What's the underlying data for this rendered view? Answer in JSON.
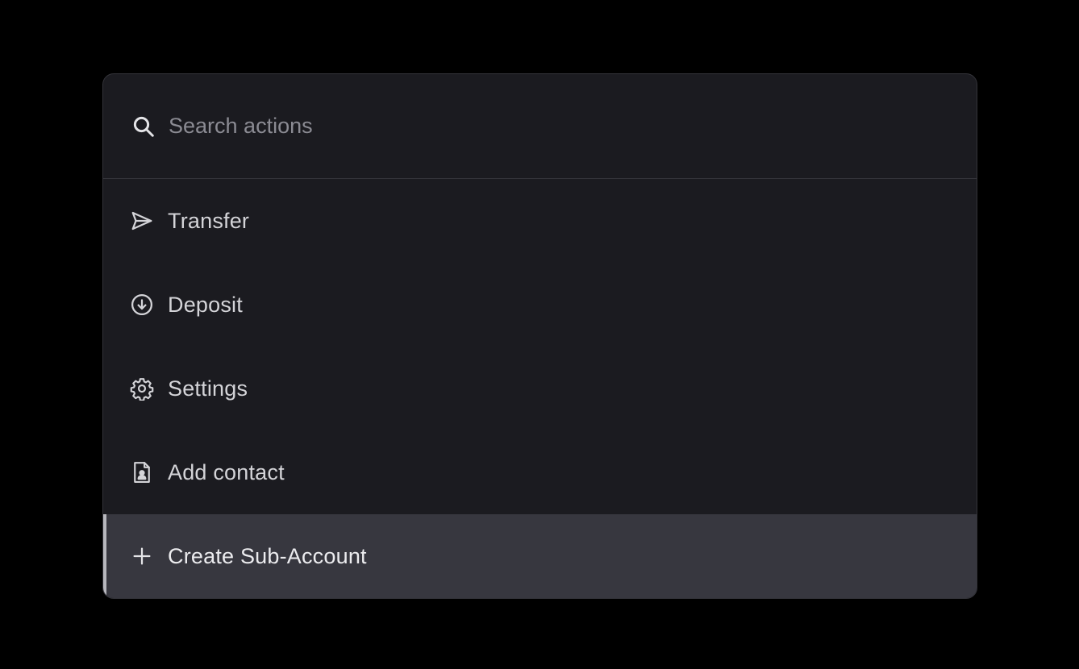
{
  "search": {
    "placeholder": "Search actions",
    "value": "",
    "icon": "search-icon"
  },
  "actions": [
    {
      "label": "Transfer",
      "icon": "send-icon",
      "active": false
    },
    {
      "label": "Deposit",
      "icon": "arrow-down-circle-icon",
      "active": false
    },
    {
      "label": "Settings",
      "icon": "gear-icon",
      "active": false
    },
    {
      "label": "Add contact",
      "icon": "contact-file-icon",
      "active": false
    },
    {
      "label": "Create Sub-Account",
      "icon": "plus-icon",
      "active": true
    }
  ],
  "colors": {
    "background": "#000000",
    "panel": "#1b1b20",
    "border": "#34343a",
    "active_row": "#37373f",
    "active_indicator": "#b7b7bd",
    "text": "#d4d4d8",
    "placeholder": "#8b8b93"
  }
}
